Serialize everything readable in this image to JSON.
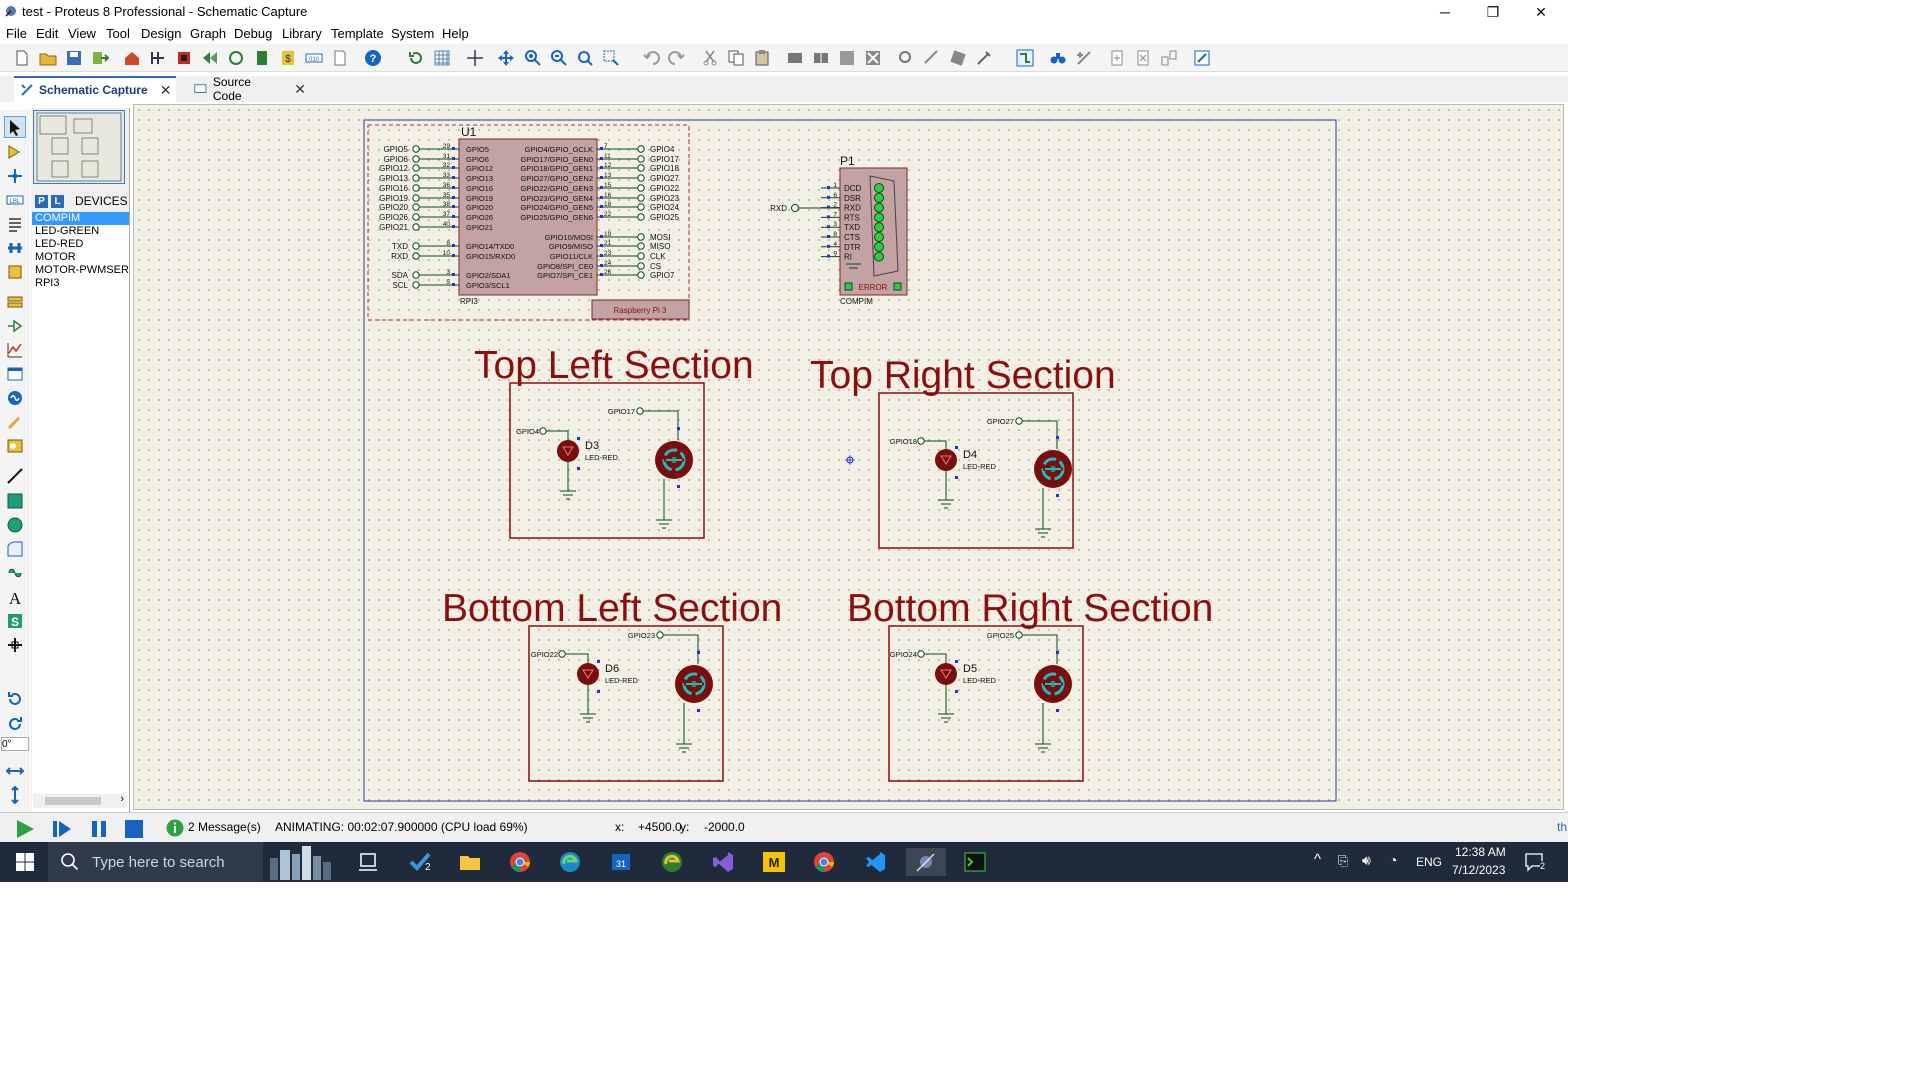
{
  "window": {
    "title": "test - Proteus 8 Professional - Schematic Capture",
    "minimize": "─",
    "restore": "❐",
    "close": "✕"
  },
  "menu": [
    "File",
    "Edit",
    "View",
    "Tool",
    "Design",
    "Graph",
    "Debug",
    "Library",
    "Template",
    "System",
    "Help"
  ],
  "tabs": [
    {
      "label": "Schematic Capture",
      "close": "✕"
    },
    {
      "label": "Source Code",
      "close": "✕"
    }
  ],
  "devices": {
    "p_label": "P",
    "l_label": "L",
    "header": "DEVICES",
    "items": [
      "COMPIM",
      "LED-GREEN",
      "LED-RED",
      "MOTOR",
      "MOTOR-PWMSER",
      "RPI3"
    ]
  },
  "rotation": "0°",
  "schematic": {
    "u1": {
      "ref": "U1",
      "part": "RPI3",
      "label": "Raspberry Pi 3",
      "left_nets": [
        "GPIO5",
        "GPIO6",
        "GPIO12",
        "GPIO13",
        "GPIO16",
        "GPIO19",
        "GPIO20",
        "GPIO26",
        "GPIO21",
        "TXD",
        "RXD",
        "SDA",
        "SCL"
      ],
      "left_nums": [
        "29",
        "31",
        "32",
        "33",
        "36",
        "35",
        "38",
        "37",
        "40",
        "8",
        "10",
        "3",
        "5"
      ],
      "left_pins": [
        "GPIO5",
        "GPIO6",
        "GPIO12",
        "GPIO13",
        "GPIO16",
        "GPIO19",
        "GPIO20",
        "GPIO26",
        "GPIO21",
        "GPIO14/TXD0",
        "GPIO15/RXD0",
        "GPIO2/SDA1",
        "GPIO3/SCL1"
      ],
      "right_pins": [
        "GPIO4/GPIO_GCLK",
        "GPIO17/GPIO_GEN0",
        "GPIO18/GPIO_GEN1",
        "GPIO27/GPIO_GEN2",
        "GPIO22/GPIO_GEN3",
        "GPIO23/GPIO_GEN4",
        "GPIO24/GPIO_GEN5",
        "GPIO25/GPIO_GEN6",
        "GPIO10/MOSI",
        "GPIO9/MISO",
        "GPIO11/CLK",
        "GPIO8/SPI_CE0",
        "GPIO7/SPI_CE1"
      ],
      "right_nums": [
        "7",
        "11",
        "12",
        "13",
        "15",
        "16",
        "18",
        "22",
        "19",
        "21",
        "23",
        "24",
        "26"
      ],
      "right_nets": [
        "GPIO4",
        "GPIO17",
        "GPIO18",
        "GPIO27",
        "GPIO22",
        "GPIO23",
        "GPIO24",
        "GPIO25",
        "MOSI",
        "MISO",
        "CLK",
        "CS",
        "GPIO7"
      ]
    },
    "p1": {
      "ref": "P1",
      "part": "COMPIM",
      "net": "RXD",
      "pins": [
        "DCD",
        "DSR",
        "RXD",
        "RTS",
        "TXD",
        "CTS",
        "DTR",
        "RI"
      ],
      "nums": [
        "1",
        "6",
        "2",
        "7",
        "3",
        "8",
        "4",
        "9"
      ],
      "error": "ERROR"
    },
    "sections": [
      {
        "title": "Top Left Section",
        "led": "D3",
        "led_type": "LED-RED",
        "led_net": "GPIO4",
        "motor_net": "GPIO17"
      },
      {
        "title": "Top Right Section",
        "led": "D4",
        "led_type": "LED-RED",
        "led_net": "GPIO18",
        "motor_net": "GPIO27"
      },
      {
        "title": "Bottom Left Section",
        "led": "D6",
        "led_type": "LED-RED",
        "led_net": "GPIO22",
        "motor_net": "GPIO23"
      },
      {
        "title": "Bottom Right Section",
        "led": "D5",
        "led_type": "LED-RED",
        "led_net": "GPIO24",
        "motor_net": "GPIO25"
      }
    ]
  },
  "status": {
    "messages": "2 Message(s)",
    "animating": "ANIMATING: 00:02:07.900000 (CPU load 69%)",
    "x_label": "x:",
    "x_value": "+4500.0",
    "y_label": "y:",
    "y_value": "-2000.0",
    "edge": "th"
  },
  "taskbar": {
    "search_placeholder": "Type here to search",
    "lang": "ENG",
    "time": "12:38 AM",
    "date": "7/12/2023",
    "notif_count": "2",
    "todo_badge": "2"
  },
  "colors": {
    "section_red": "#8b0f0f",
    "component_fill": "#c2a2a2",
    "wire": "#0a4a14",
    "pin_blue": "#2d2dd6",
    "accent": "#2b6bb5"
  }
}
